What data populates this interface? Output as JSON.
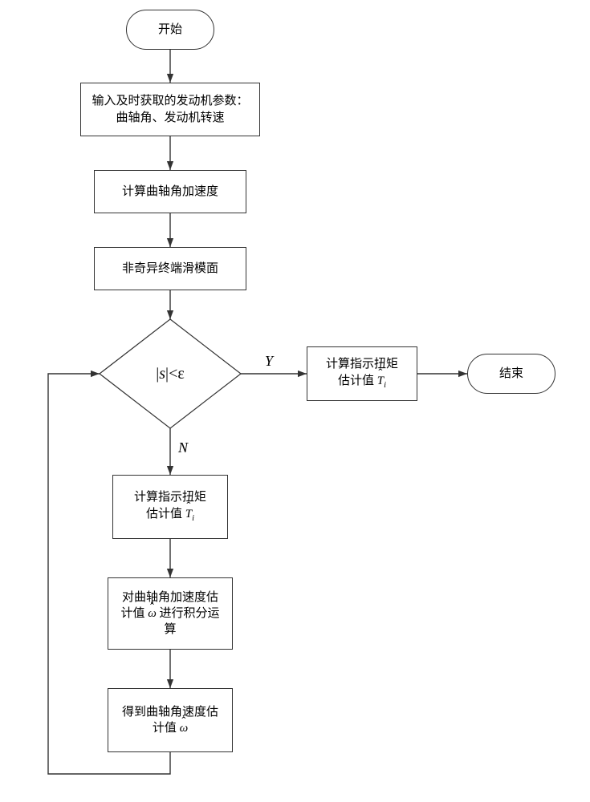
{
  "nodes": {
    "start": "开始",
    "end": "结束",
    "input": "输入及时获取的发动机参数：曲轴角、发动机转速",
    "calc_acc": "计算曲轴角加速度",
    "surface": "非奇异终端滑模面",
    "decision_lhs_open": "|",
    "decision_var": "s",
    "decision_lhs_close": "|",
    "decision_op": " < ",
    "decision_rhs": "ε",
    "calc_T_right_prefix": "计算指示扭矩",
    "calc_T_right_mid": "估计值 ",
    "calc_T_down_prefix": "计算指示扭矩",
    "calc_T_down_mid": "估计值 ",
    "T_symbol": "T",
    "T_sub": "i",
    "integrate_prefix": "对曲轴角加速度估",
    "integrate_mid": "计值 ",
    "integrate_suffix": " 进行积分运",
    "integrate_last": "算",
    "omega_sym_acc": "ω",
    "result_prefix": "得到曲轴角速度估",
    "result_mid": "计值 ",
    "omega_sym_vel": "ω"
  },
  "edges": {
    "yes": "Y",
    "no": "N"
  }
}
